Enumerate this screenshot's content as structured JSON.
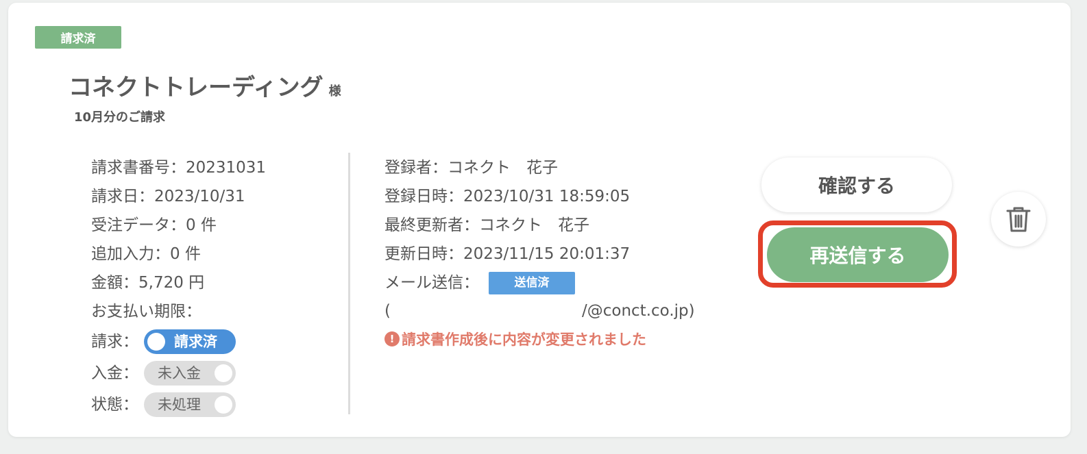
{
  "status_badge": "請求済",
  "client": {
    "name": "コネクトトレーディング",
    "suffix": "様"
  },
  "subtitle": "10月分のご請求",
  "left": {
    "invoice_number": {
      "label": "請求書番号：",
      "value": "20231031"
    },
    "invoice_date": {
      "label": "請求日：",
      "value": "2023/10/31"
    },
    "orders": {
      "label": "受注データ：",
      "value": "0 件"
    },
    "additional": {
      "label": "追加入力：",
      "value": "0 件"
    },
    "amount": {
      "label": "金額：",
      "value": "5,720 円"
    },
    "due": {
      "label": "お支払い期限：",
      "value": ""
    },
    "billing": {
      "label": "請求：",
      "toggle": "請求済",
      "on": true
    },
    "payment": {
      "label": "入金：",
      "toggle": "未入金",
      "on": false
    },
    "state": {
      "label": "状態：",
      "toggle": "未処理",
      "on": false
    }
  },
  "middle": {
    "registrant": {
      "label": "登録者：",
      "value": "コネクト　花子"
    },
    "registered_at": {
      "label": "登録日時：",
      "value": "2023/10/31 18:59:05"
    },
    "last_updater": {
      "label": "最終更新者：",
      "value": "コネクト　花子"
    },
    "updated_at": {
      "label": "更新日時：",
      "value": "2023/11/15 20:01:37"
    },
    "mail": {
      "label": "メール送信：",
      "badge": "送信済"
    },
    "email_open": "(",
    "email_tail": "/@conct.co.jp)",
    "warning": "請求書作成後に内容が変更されました",
    "warning_icon": "!"
  },
  "actions": {
    "confirm": "確認する",
    "resend": "再送信する",
    "delete_icon": "trash-icon"
  },
  "colors": {
    "green": "#7db785",
    "blue": "#4a90d9",
    "warning": "#e07a6a",
    "highlight": "#e2402a"
  }
}
